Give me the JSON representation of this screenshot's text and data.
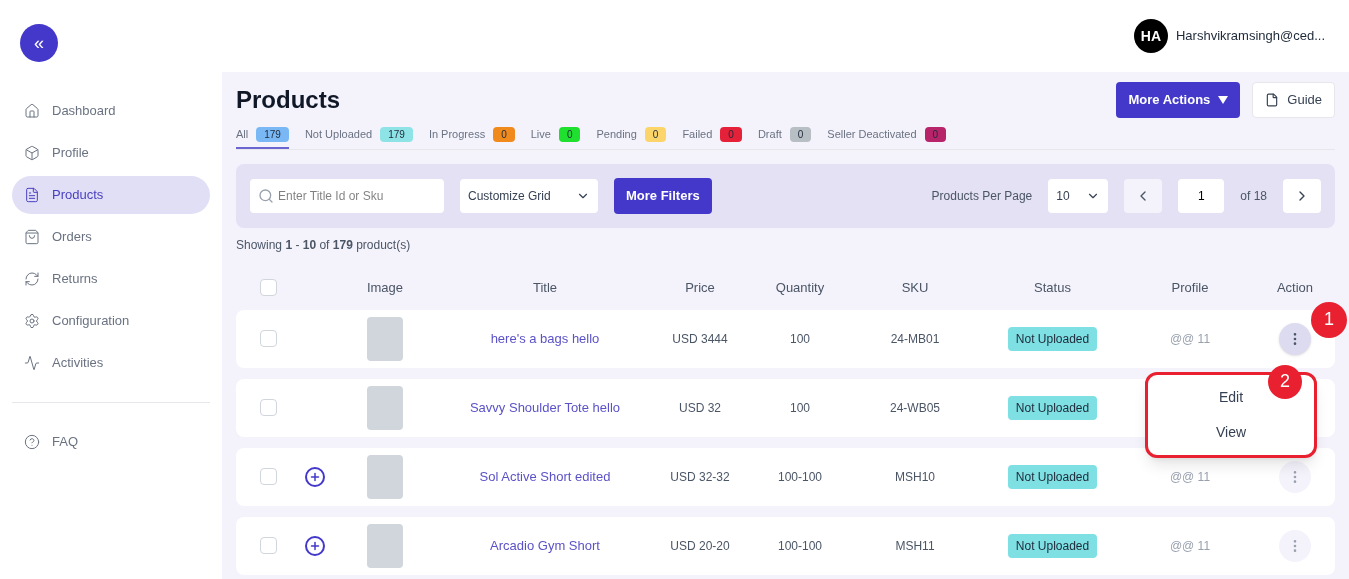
{
  "sidebar": {
    "collapse_button": "«",
    "items": [
      {
        "label": "Dashboard",
        "selected": false
      },
      {
        "label": "Profile",
        "selected": false
      },
      {
        "label": "Products",
        "selected": true
      },
      {
        "label": "Orders",
        "selected": false
      },
      {
        "label": "Returns",
        "selected": false
      },
      {
        "label": "Configuration",
        "selected": false
      },
      {
        "label": "Activities",
        "selected": false
      }
    ],
    "footer_items": [
      {
        "label": "FAQ",
        "selected": false
      }
    ]
  },
  "user": {
    "initials": "HA",
    "email": "Harshvikramsingh@ced..."
  },
  "page": {
    "title": "Products",
    "buttons": [
      {
        "kind": "primary",
        "label": "More Actions"
      },
      {
        "kind": "guide",
        "label": "Guide"
      }
    ]
  },
  "tabs": [
    {
      "label": "All",
      "count": "179",
      "color": "#7ab8f5",
      "selected": true
    },
    {
      "label": "Not Uploaded",
      "count": "179",
      "color": "#8ee3e6",
      "selected": false
    },
    {
      "label": "In Progress",
      "count": "0",
      "color": "#f08a1c",
      "selected": false
    },
    {
      "label": "Live",
      "count": "0",
      "color": "#1fdf2f",
      "selected": false
    },
    {
      "label": "Pending",
      "count": "0",
      "color": "#fcd56a",
      "selected": false
    },
    {
      "label": "Failed",
      "count": "0",
      "color": "#e5213a",
      "selected": false
    },
    {
      "label": "Draft",
      "count": "0",
      "color": "#b7bec4",
      "selected": false
    },
    {
      "label": "Seller Deactivated",
      "count": "0",
      "color": "#b8246a",
      "selected": false
    }
  ],
  "filters": {
    "search": {
      "placeholder": "Enter Title Id or Sku"
    },
    "grid_select": "Customize Grid",
    "more_filters": "More Filters",
    "per_page_label": "Products Per Page",
    "per_page": "10",
    "page": "1",
    "page_total": "of 18"
  },
  "summary": "Showing **1** - **10** of  **179** product(s)",
  "table": {
    "select_all": {
      "checked": false
    },
    "columns": [
      "Image",
      "Title",
      "Price",
      "Quantity",
      "SKU",
      "Status",
      "Profile",
      "Action"
    ],
    "rows": [
      {
        "checked": false,
        "expandable": false,
        "title": "here's a bags hello",
        "price": "USD 3444",
        "quantity": "100",
        "sku": "24-MB01",
        "status": "Not Uploaded",
        "profile": "@@ 11",
        "menu_open": true
      },
      {
        "checked": false,
        "expandable": false,
        "title": "Savvy Shoulder Tote hello",
        "price": "USD 32",
        "quantity": "100",
        "sku": "24-WB05",
        "status": "Not Uploaded",
        "menu_open": false
      },
      {
        "checked": false,
        "expandable": true,
        "title": "Sol Active Short edited",
        "price": "USD 32-32",
        "quantity": "100-100",
        "sku": "MSH10",
        "status": "Not Uploaded",
        "profile": "@@ 11",
        "menu_open": false
      },
      {
        "checked": false,
        "expandable": true,
        "title": "Arcadio Gym Short",
        "price": "USD 20-20",
        "quantity": "100-100",
        "sku": "MSH11",
        "status": "Not Uploaded",
        "profile": "@@ 11",
        "menu_open": false
      }
    ]
  },
  "action_menu": {
    "items": [
      "Edit",
      "View"
    ]
  },
  "annotations": [
    {
      "label": "1"
    },
    {
      "label": "2"
    }
  ]
}
